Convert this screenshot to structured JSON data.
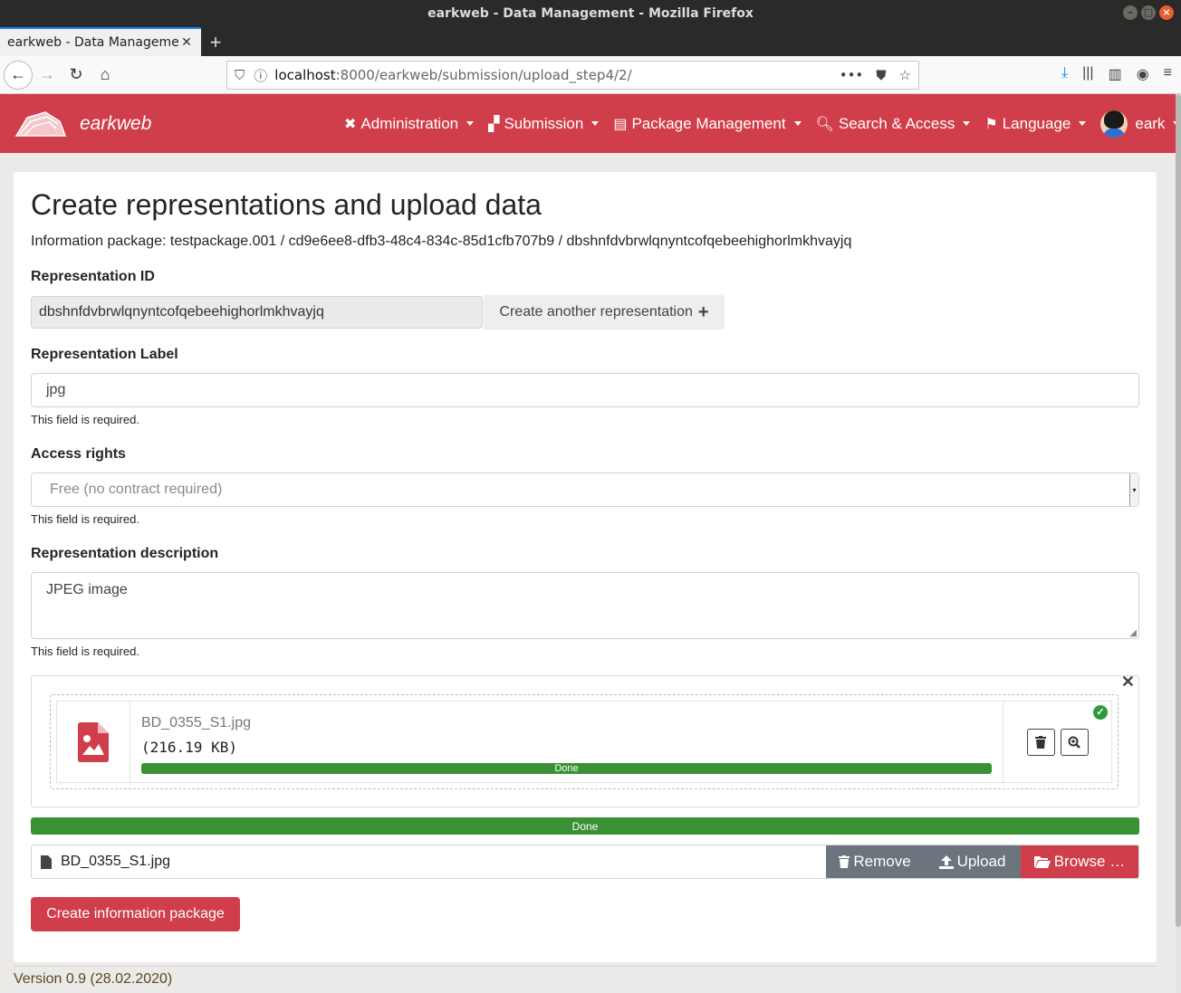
{
  "window": {
    "title": "earkweb - Data Management - Mozilla Firefox"
  },
  "tab": {
    "title": "earkweb - Data Managemen"
  },
  "url": {
    "host": "localhost",
    "path": ":8000/earkweb/submission/upload_step4/2/"
  },
  "app": {
    "brand": "earkweb",
    "menu": [
      {
        "label": "Administration",
        "icon": "tools-icon"
      },
      {
        "label": "Submission",
        "icon": "boxes-icon"
      },
      {
        "label": "Package Management",
        "icon": "archive-icon"
      },
      {
        "label": "Search & Access",
        "icon": "search-icon"
      },
      {
        "label": "Language",
        "icon": "flag-icon"
      },
      {
        "label": "eark",
        "icon": "avatar"
      }
    ]
  },
  "page": {
    "title": "Create representations and upload data",
    "info": "Information package: testpackage.001 / cd9e6ee8-dfb3-48c4-834c-85d1cfb707b9 / dbshnfdvbrwlqnyntcofqebeehighorlmkhvayjq",
    "representation_id": {
      "label": "Representation ID",
      "value": "dbshnfdvbrwlqnyntcofqebeehighorlmkhvayjq",
      "create_button": "Create another representation"
    },
    "representation_label": {
      "label": "Representation Label",
      "value": "jpg",
      "help": "This field is required."
    },
    "access_rights": {
      "label": "Access rights",
      "selected": "Free (no contract required)",
      "help": "This field is required."
    },
    "description": {
      "label": "Representation description",
      "value": "JPEG image",
      "help": "This field is required."
    },
    "upload": {
      "file_name": "BD_0355_S1.jpg",
      "file_size": "(216.19 KB)",
      "file_progress_label": "Done",
      "file_progress": 100,
      "total_progress_label": "Done",
      "total_progress": 100,
      "caption": "BD_0355_S1.jpg",
      "remove_label": "Remove",
      "upload_label": "Upload",
      "browse_label": "Browse …"
    },
    "submit_button": "Create information package"
  },
  "footer": {
    "version": "Version 0.9 (28.02.2020)"
  },
  "colors": {
    "brand": "#cf3e4a",
    "success": "#3a9134",
    "dark_button": "#6c757d"
  }
}
